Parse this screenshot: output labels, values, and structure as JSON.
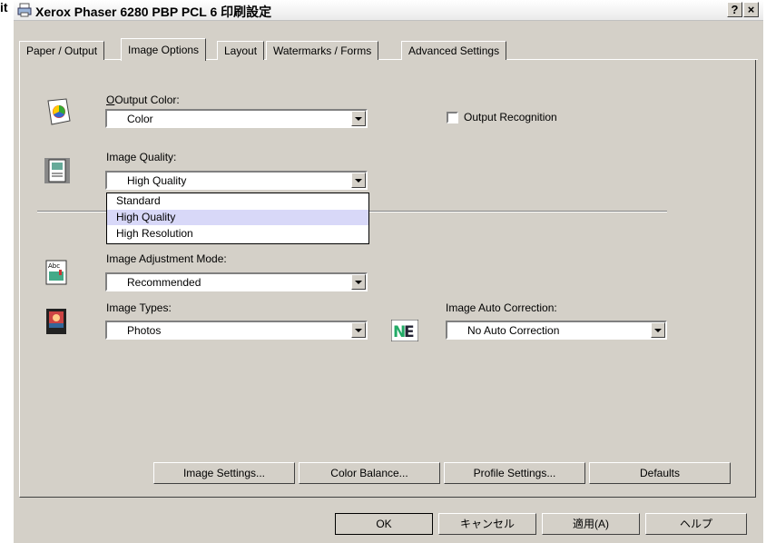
{
  "stray_text": "it",
  "window": {
    "title": "Xerox Phaser 6280 PBP PCL 6 印刷設定",
    "help_label": "?",
    "close_label": "×"
  },
  "tabs": [
    {
      "label": "Paper / Output"
    },
    {
      "label": "Image Options"
    },
    {
      "label": "Layout"
    },
    {
      "label": "Watermarks / Forms"
    },
    {
      "label": "Advanced Settings"
    }
  ],
  "output_color": {
    "label": "Output Color:",
    "value": "Color"
  },
  "output_recognition": {
    "label": "Output Recognition",
    "checked": false
  },
  "image_quality": {
    "label": "Image Quality:",
    "value": "High Quality",
    "options": [
      "Standard",
      "High Quality",
      "High Resolution"
    ]
  },
  "image_adjustment_mode": {
    "label": "Image Adjustment Mode:",
    "value": "Recommended"
  },
  "image_types": {
    "label": "Image Types:",
    "value": "Photos"
  },
  "image_auto_correction": {
    "label": "Image Auto Correction:",
    "value": "No Auto Correction"
  },
  "panel_buttons": {
    "image_settings": "Image Settings...",
    "color_balance": "Color Balance...",
    "profile_settings": "Profile Settings...",
    "defaults": "Defaults"
  },
  "dialog_buttons": {
    "ok": "OK",
    "cancel": "キャンセル",
    "apply": "適用(A)",
    "help": "ヘルプ"
  },
  "icons": {
    "window": "printer-icon",
    "output_color": "color-wheel-icon",
    "image_quality": "image-document-icon",
    "adjustment": "document-image-icon",
    "image_types": "photo-document-icon",
    "auto_correction": "ne-icon"
  }
}
